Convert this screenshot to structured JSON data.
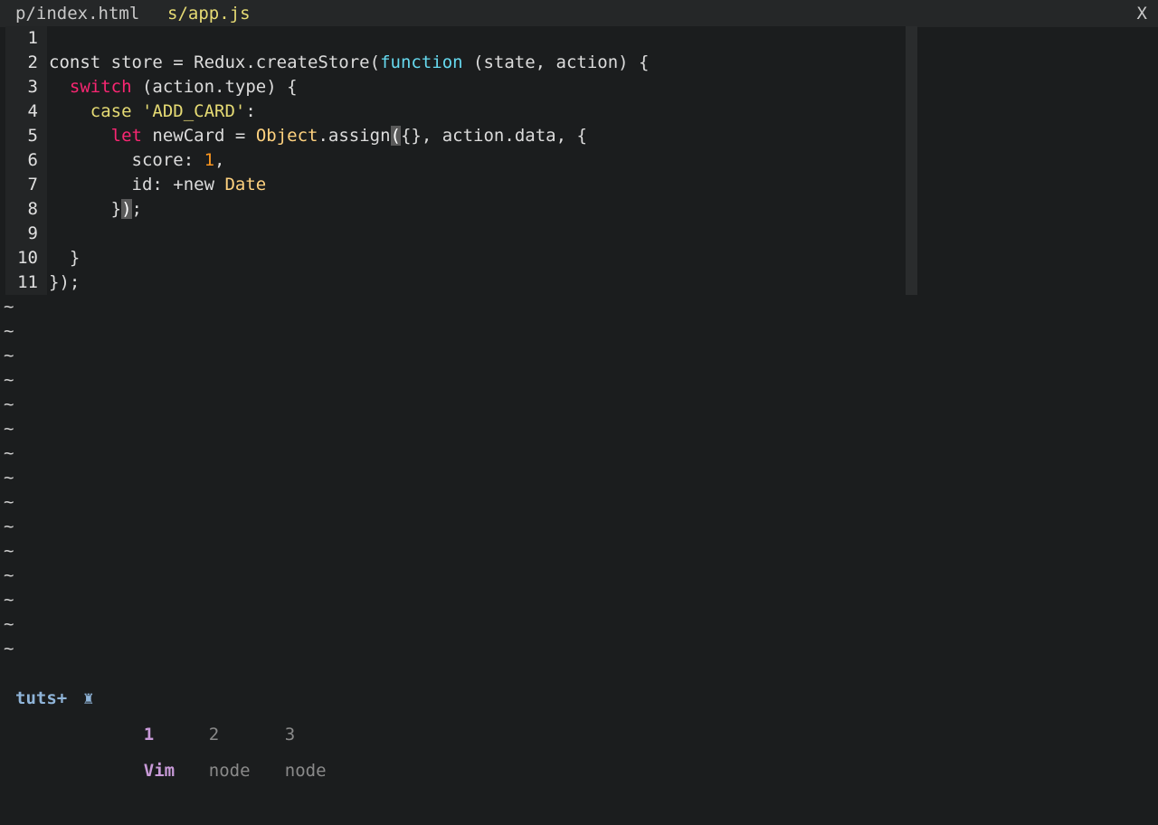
{
  "tabs": [
    {
      "label": "p/index.html",
      "active": false
    },
    {
      "label": "s/app.js",
      "active": true
    }
  ],
  "close_label": "X",
  "lines": [
    {
      "n": "1"
    },
    {
      "n": "2",
      "t": [
        {
          "c": "kw-const",
          "v": "const"
        },
        {
          "v": " store = Redux.createStore("
        },
        {
          "c": "kw-fn",
          "v": "function"
        },
        {
          "v": " (state, action) {"
        }
      ]
    },
    {
      "n": "3",
      "t": [
        {
          "v": "  "
        },
        {
          "c": "kw-red",
          "v": "switch"
        },
        {
          "v": " (action.type) {"
        }
      ]
    },
    {
      "n": "4",
      "t": [
        {
          "v": "    "
        },
        {
          "c": "kw-case",
          "v": "case"
        },
        {
          "v": " "
        },
        {
          "c": "str",
          "v": "'ADD_CARD'"
        },
        {
          "v": ":"
        }
      ]
    },
    {
      "n": "5",
      "t": [
        {
          "v": "      "
        },
        {
          "c": "kw-red",
          "v": "let"
        },
        {
          "v": " newCard = "
        },
        {
          "c": "cls",
          "v": "Object"
        },
        {
          "v": ".assign"
        },
        {
          "c": "cur",
          "v": "("
        },
        {
          "v": "{}, action.data, {"
        }
      ]
    },
    {
      "n": "6",
      "t": [
        {
          "v": "        score: "
        },
        {
          "c": "num",
          "v": "1"
        },
        {
          "v": ","
        }
      ]
    },
    {
      "n": "7",
      "t": [
        {
          "v": "        id: +new "
        },
        {
          "c": "cls",
          "v": "Date"
        }
      ]
    },
    {
      "n": "8",
      "t": [
        {
          "v": "      }"
        },
        {
          "c": "cur",
          "v": ")"
        },
        {
          "v": ";"
        }
      ]
    },
    {
      "n": "9"
    },
    {
      "n": "10",
      "t": [
        {
          "v": "  }"
        }
      ]
    },
    {
      "n": "11",
      "t": [
        {
          "v": "});"
        }
      ]
    }
  ],
  "tilde_char": "~",
  "tilde_count": 15,
  "status": {
    "session": "tuts+",
    "windows": [
      {
        "index": "1",
        "name": "Vim",
        "active": true
      },
      {
        "index": "2",
        "name": "node",
        "active": false
      },
      {
        "index": "3",
        "name": "node",
        "active": false
      }
    ]
  }
}
